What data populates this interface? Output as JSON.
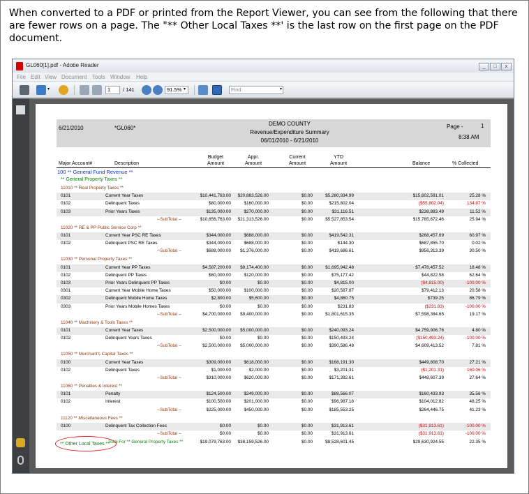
{
  "caption": "When converted to a PDF or printed from the Report Viewer, you can see from the following that there are fewer rows on a page.  The \"** Other Local Taxes **' is the last row on the first page on the PDF document.",
  "window": {
    "title": "GL060[1].pdf - Adobe Reader",
    "menu": [
      "File",
      "Edit",
      "View",
      "Document",
      "Tools",
      "Window",
      "Help"
    ],
    "page_current": "1",
    "page_total": "/ 141",
    "zoom": "91.5%",
    "find_placeholder": "Find",
    "controls": [
      "_",
      "□",
      "x"
    ]
  },
  "report": {
    "date": "6/21/2010",
    "report_id": "*GL060*",
    "county": "DEMO COUNTY",
    "title": "Revenue/Expenditure Summary",
    "range": "06/01/2010 - 6/21/2010",
    "page_label": "Page -",
    "page_num": "1",
    "time": "8:38 AM",
    "columns": {
      "account": "Major Account#",
      "description": "Description",
      "budget_1": "Budget",
      "budget_2": "Amount",
      "appr_1": "Appr.",
      "appr_2": "Amount",
      "current_1": "Current",
      "current_2": "Amount",
      "ytd_1": "YTD",
      "ytd_2": "Amount",
      "balance": "Balance",
      "collected": "% Collected"
    },
    "fund_label": "100 ** General Fund Revenue **",
    "category_label": "** General Property Taxes **",
    "sections": [
      {
        "title": "11010 ** Real Property Taxes **",
        "rows": [
          {
            "acct": "0101",
            "desc": "Current Year Taxes",
            "budget": "$10,441,763.00",
            "appr": "$20,883,526.00",
            "current": "$0.00",
            "ytd": "$5,280,934.99",
            "balance": "$15,602,591.01",
            "pct": "25.28 %"
          },
          {
            "acct": "0102",
            "desc": "Delinquent Taxes",
            "budget": "$80,000.00",
            "appr": "$160,000.00",
            "current": "$0.00",
            "ytd": "$215,802.04",
            "balance": "($55,802.04)",
            "pct": "134.87 %",
            "neg": true
          },
          {
            "acct": "0103",
            "desc": "Prior Years Taxes",
            "budget": "$135,000.00",
            "appr": "$270,000.00",
            "current": "$0.00",
            "ytd": "$31,116.51",
            "balance": "$238,883.49",
            "pct": "11.52 %"
          }
        ],
        "subtotal": {
          "label": "--SubTotal --",
          "budget": "$10,656,763.00",
          "appr": "$21,313,526.00",
          "current": "$0.00",
          "ytd": "$5,527,853.54",
          "balance": "$15,785,672.46",
          "pct": "25.94 %"
        }
      },
      {
        "title": "11020 ** RE & PP Public Service Corp **",
        "rows": [
          {
            "acct": "0101",
            "desc": "Current Year PSC RE Taxes",
            "budget": "$344,000.00",
            "appr": "$688,000.00",
            "current": "$0.00",
            "ytd": "$419,542.31",
            "balance": "$268,457.69",
            "pct": "60.97 %"
          },
          {
            "acct": "0102",
            "desc": "Delinquent PSC RE Taxes",
            "budget": "$344,000.00",
            "appr": "$688,000.00",
            "current": "$0.00",
            "ytd": "$144.30",
            "balance": "$687,855.70",
            "pct": "0.02 %"
          }
        ],
        "subtotal": {
          "label": "--SubTotal --",
          "budget": "$688,000.00",
          "appr": "$1,376,000.00",
          "current": "$0.00",
          "ytd": "$419,686.61",
          "balance": "$956,313.39",
          "pct": "30.50 %"
        }
      },
      {
        "title": "11030 ** Personal Property Taxes **",
        "rows": [
          {
            "acct": "0101",
            "desc": "Current Year PP Taxes",
            "budget": "$4,587,200.00",
            "appr": "$9,174,400.00",
            "current": "$0.00",
            "ytd": "$1,695,942.48",
            "balance": "$7,478,457.52",
            "pct": "18.48 %"
          },
          {
            "acct": "0102",
            "desc": "Delinquent PP Taxes",
            "budget": "$60,000.00",
            "appr": "$120,000.00",
            "current": "$0.00",
            "ytd": "$75,177.42",
            "balance": "$44,822.58",
            "pct": "62.64 %"
          },
          {
            "acct": "0103",
            "desc": "Prior Years Delinquent PP Taxes",
            "budget": "$0.00",
            "appr": "$0.00",
            "current": "$0.00",
            "ytd": "$4,815.00",
            "balance": "($4,815.00)",
            "pct": "-100.00 %",
            "neg": true
          },
          {
            "acct": "0301",
            "desc": "Current Year Mobile Home Taxes",
            "budget": "$50,000.00",
            "appr": "$100,000.00",
            "current": "$0.00",
            "ytd": "$20,587.87",
            "balance": "$79,412.13",
            "pct": "20.58 %"
          },
          {
            "acct": "0302",
            "desc": "Delinquent Mobile Home Taxes",
            "budget": "$2,800.00",
            "appr": "$5,600.00",
            "current": "$0.00",
            "ytd": "$4,860.75",
            "balance": "$739.25",
            "pct": "86.79 %"
          },
          {
            "acct": "0303",
            "desc": "Prior Years Mobile Homes Taxes",
            "budget": "$0.00",
            "appr": "$0.00",
            "current": "$0.00",
            "ytd": "$231.83",
            "balance": "($231.83)",
            "pct": "-100.00 %",
            "neg": true
          }
        ],
        "subtotal": {
          "label": "--SubTotal --",
          "budget": "$4,700,000.00",
          "appr": "$9,400,000.00",
          "current": "$0.00",
          "ytd": "$1,801,615.35",
          "balance": "$7,598,384.65",
          "pct": "19.17 %"
        }
      },
      {
        "title": "11040 ** Machinery & Tools Taxes **",
        "rows": [
          {
            "acct": "0101",
            "desc": "Current Year Taxes",
            "budget": "$2,500,000.00",
            "appr": "$5,000,000.00",
            "current": "$0.00",
            "ytd": "$240,093.24",
            "balance": "$4,759,906.76",
            "pct": "4.80 %"
          },
          {
            "acct": "0102",
            "desc": "Delinquent Years Taxes",
            "budget": "$0.00",
            "appr": "$0.00",
            "current": "$0.00",
            "ytd": "$150,493.24",
            "balance": "($150,493.24)",
            "pct": "-100.00 %",
            "neg": true
          }
        ],
        "subtotal": {
          "label": "--SubTotal --",
          "budget": "$2,500,000.00",
          "appr": "$5,000,000.00",
          "current": "$0.00",
          "ytd": "$390,586.48",
          "balance": "$4,609,413.52",
          "pct": "7.81 %"
        }
      },
      {
        "title": "11050 ** Merchant's Capital Taxes **",
        "rows": [
          {
            "acct": "0100",
            "desc": "Current Year Taxes",
            "budget": "$309,000.00",
            "appr": "$618,000.00",
            "current": "$0.00",
            "ytd": "$168,191.30",
            "balance": "$449,808.70",
            "pct": "27.21 %"
          },
          {
            "acct": "0102",
            "desc": "Delinquent Taxes",
            "budget": "$1,000.00",
            "appr": "$2,000.00",
            "current": "$0.00",
            "ytd": "$3,201.31",
            "balance": "($1,201.31)",
            "pct": "160.06 %",
            "neg": true
          }
        ],
        "subtotal": {
          "label": "--SubTotal --",
          "budget": "$310,000.00",
          "appr": "$620,000.00",
          "current": "$0.00",
          "ytd": "$171,392.61",
          "balance": "$448,607.39",
          "pct": "27.64 %"
        }
      },
      {
        "title": "11060 ** Penalties & Interest **",
        "rows": [
          {
            "acct": "0101",
            "desc": "Penalty",
            "budget": "$124,500.00",
            "appr": "$249,000.00",
            "current": "$0.00",
            "ytd": "$88,566.07",
            "balance": "$160,433.93",
            "pct": "35.56 %"
          },
          {
            "acct": "0102",
            "desc": "Interest",
            "budget": "$100,500.00",
            "appr": "$201,000.00",
            "current": "$0.00",
            "ytd": "$96,987.18",
            "balance": "$104,012.82",
            "pct": "48.25 %"
          }
        ],
        "subtotal": {
          "label": "--SubTotal --",
          "budget": "$225,000.00",
          "appr": "$450,000.00",
          "current": "$0.00",
          "ytd": "$185,553.25",
          "balance": "$264,446.75",
          "pct": "41.23 %"
        }
      },
      {
        "title": "11120 ** Miscellaneous Fees **",
        "rows": [
          {
            "acct": "0100",
            "desc": "Delinquent Tax Collection Fees",
            "budget": "$0.00",
            "appr": "$0.00",
            "current": "$0.00",
            "ytd": "$31,913.61",
            "balance": "($31,913.61)",
            "pct": "-100.00 %",
            "neg": true
          }
        ],
        "subtotal": {
          "label": "--SubTotal --",
          "budget": "$0.00",
          "appr": "$0.00",
          "current": "$0.00",
          "ytd": "$31,913.61",
          "balance": "($31,913.61)",
          "pct": "-100.00 %",
          "neg": true
        }
      }
    ],
    "total": {
      "label": "Total For  ** General Property Taxes **",
      "budget": "$19,079,763.00",
      "appr": "$38,159,526.00",
      "current": "$0.00",
      "ytd": "$8,528,601.45",
      "balance": "$29,630,924.55",
      "pct": "22.35 %"
    },
    "other_local": "** Other Local Taxes **",
    "colors": {
      "fund": "#0a2bd6",
      "category": "#0a7d10",
      "section": "#8a3b12",
      "negative": "#d00000",
      "annotation": "#e02020"
    }
  }
}
